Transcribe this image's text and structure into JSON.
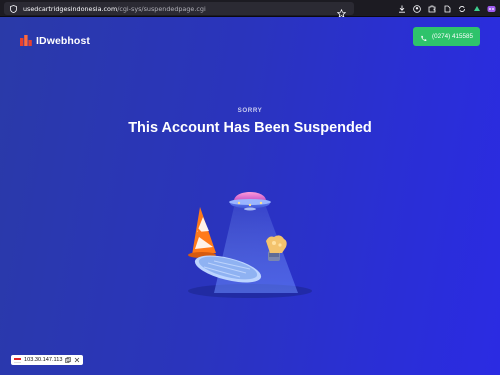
{
  "browser": {
    "url_host": "usedcartridgesindonesia.com",
    "url_path": "/cgi-sys/suspendedpage.cgi",
    "icons": [
      "shield-icon",
      "star-icon",
      "download-icon",
      "account-icon",
      "extensions-icon",
      "puzzle-icon",
      "sync-icon",
      "ext-green-icon",
      "ext-purple-icon"
    ]
  },
  "header": {
    "logo_text": "IDwebhost",
    "phone_label": "(0274) 415585"
  },
  "main": {
    "eyebrow": "SORRY",
    "title": "This Account Has Been Suspended",
    "illustration": [
      "ufo",
      "traffic-cone",
      "manhole-cover",
      "fist-robot"
    ]
  },
  "ip_badge": {
    "ip": "103.30.147.113"
  },
  "colors": {
    "bg_start": "#2a3aa8",
    "bg_end": "#2b2be3",
    "button_green": "#2ec36b",
    "logo_red": "#e8402f"
  }
}
